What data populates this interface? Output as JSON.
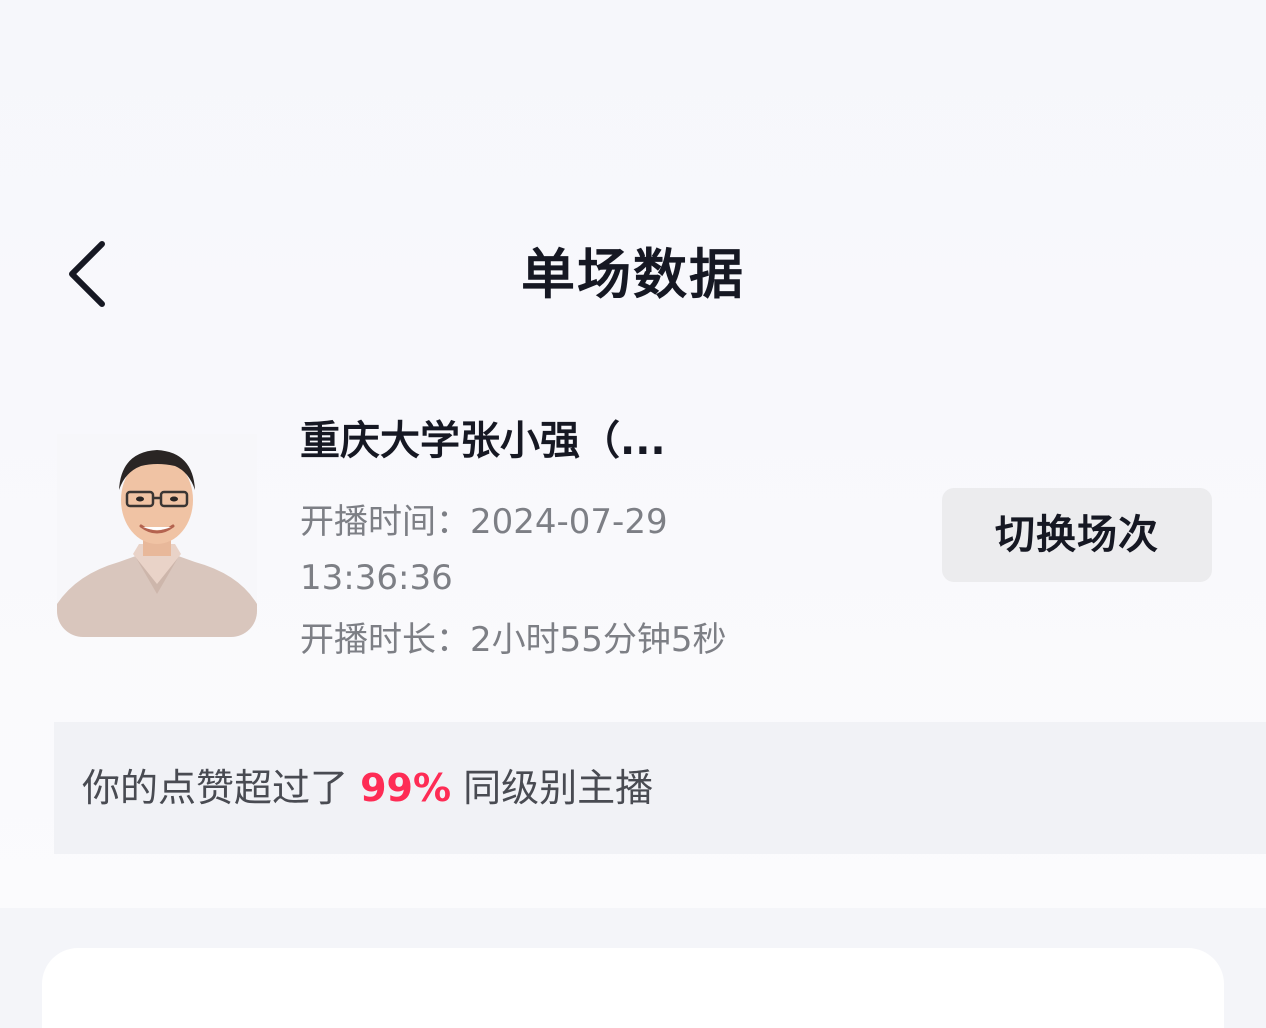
{
  "header": {
    "title": "单场数据",
    "back_icon": "chevron-left-icon"
  },
  "session": {
    "anchor_name": "重庆大学张小强（...",
    "start_time_label": "开播时间：",
    "start_time_date": "2024-07-29",
    "start_time_clock": "13:36:36",
    "duration_label": "开播时长：",
    "duration_value": "2小时55分钟5秒",
    "switch_button_label": "切换场次"
  },
  "comparison": {
    "prefix": "你的点赞超过了",
    "percent": "99%",
    "suffix": "同级别主播",
    "highlight_color": "#fe2c55"
  }
}
